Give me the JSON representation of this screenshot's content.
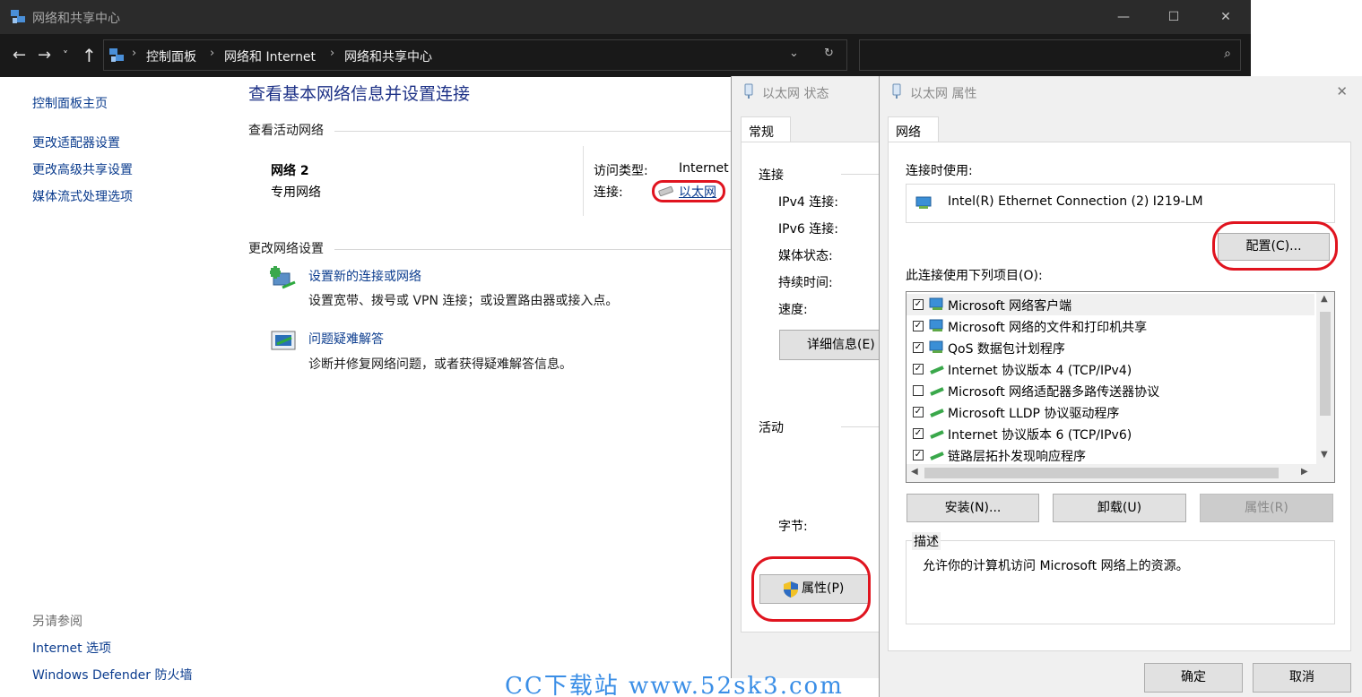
{
  "main": {
    "title": "网络和共享中心",
    "controls": {
      "minimize": "—",
      "maximize": "☐",
      "close": "✕"
    },
    "nav": {
      "back": "←",
      "forward": "→",
      "recent": "˅",
      "up": "↑"
    },
    "breadcrumbs": [
      "控制面板",
      "网络和 Internet",
      "网络和共享中心"
    ],
    "search_placeholder": "",
    "left_pane": {
      "home": "控制面板主页",
      "links": [
        "更改适配器设置",
        "更改高级共享设置",
        "媒体流式处理选项"
      ],
      "see_also_title": "另请参阅",
      "see_also": [
        "Internet 选项",
        "Windows Defender 防火墙"
      ]
    },
    "content": {
      "page_title": "查看基本网络信息并设置连接",
      "active_networks_label": "查看活动网络",
      "network_name": "网络 2",
      "network_type": "专用网络",
      "access_type_label": "访问类型:",
      "access_type_value": "Internet",
      "connection_label": "连接:",
      "connection_value": "以太网",
      "change_settings_label": "更改网络设置",
      "actions": [
        {
          "link": "设置新的连接或网络",
          "desc": "设置宽带、拨号或 VPN 连接；或设置路由器或接入点。"
        },
        {
          "link": "问题疑难解答",
          "desc": "诊断并修复网络问题，或者获得疑难解答信息。"
        }
      ]
    }
  },
  "status_dialog": {
    "title": "以太网 状态",
    "tab": "常规",
    "connection_group": "连接",
    "fields": [
      "IPv4 连接:",
      "IPv6 连接:",
      "媒体状态:",
      "持续时间:",
      "速度:"
    ],
    "details_button": "详细信息(E)",
    "activity_group": "活动",
    "bytes_label": "字节:",
    "properties_button": "属性(P)"
  },
  "props_dialog": {
    "title": "以太网 属性",
    "close": "✕",
    "tab": "网络",
    "connect_using_label": "连接时使用:",
    "adapter_name": "Intel(R) Ethernet Connection (2) I219-LM",
    "configure_button": "配置(C)...",
    "items_label": "此连接使用下列项目(O):",
    "items": [
      {
        "label": "Microsoft 网络客户端",
        "checked": true,
        "icon": "network-client-icon"
      },
      {
        "label": "Microsoft 网络的文件和打印机共享",
        "checked": true,
        "icon": "file-share-icon"
      },
      {
        "label": "QoS 数据包计划程序",
        "checked": true,
        "icon": "qos-icon"
      },
      {
        "label": "Internet 协议版本 4 (TCP/IPv4)",
        "checked": true,
        "icon": "protocol-icon"
      },
      {
        "label": "Microsoft 网络适配器多路传送器协议",
        "checked": false,
        "icon": "protocol-icon"
      },
      {
        "label": "Microsoft LLDP 协议驱动程序",
        "checked": true,
        "icon": "protocol-icon"
      },
      {
        "label": "Internet 协议版本 6 (TCP/IPv6)",
        "checked": true,
        "icon": "protocol-icon"
      },
      {
        "label": "链路层拓扑发现响应程序",
        "checked": true,
        "icon": "protocol-icon"
      }
    ],
    "install_button": "安装(N)...",
    "uninstall_button": "卸载(U)",
    "properties_button": "属性(R)",
    "description_group": "描述",
    "description_text": "允许你的计算机访问 Microsoft 网络上的资源。",
    "ok_button": "确定",
    "cancel_button": "取消"
  },
  "watermark": "CC下载站 www.52sk3.com",
  "colors": {
    "link": "#0b3c8e",
    "title": "#1e3287",
    "highlight_ring": "#e0141f",
    "check_mark": "✓"
  }
}
